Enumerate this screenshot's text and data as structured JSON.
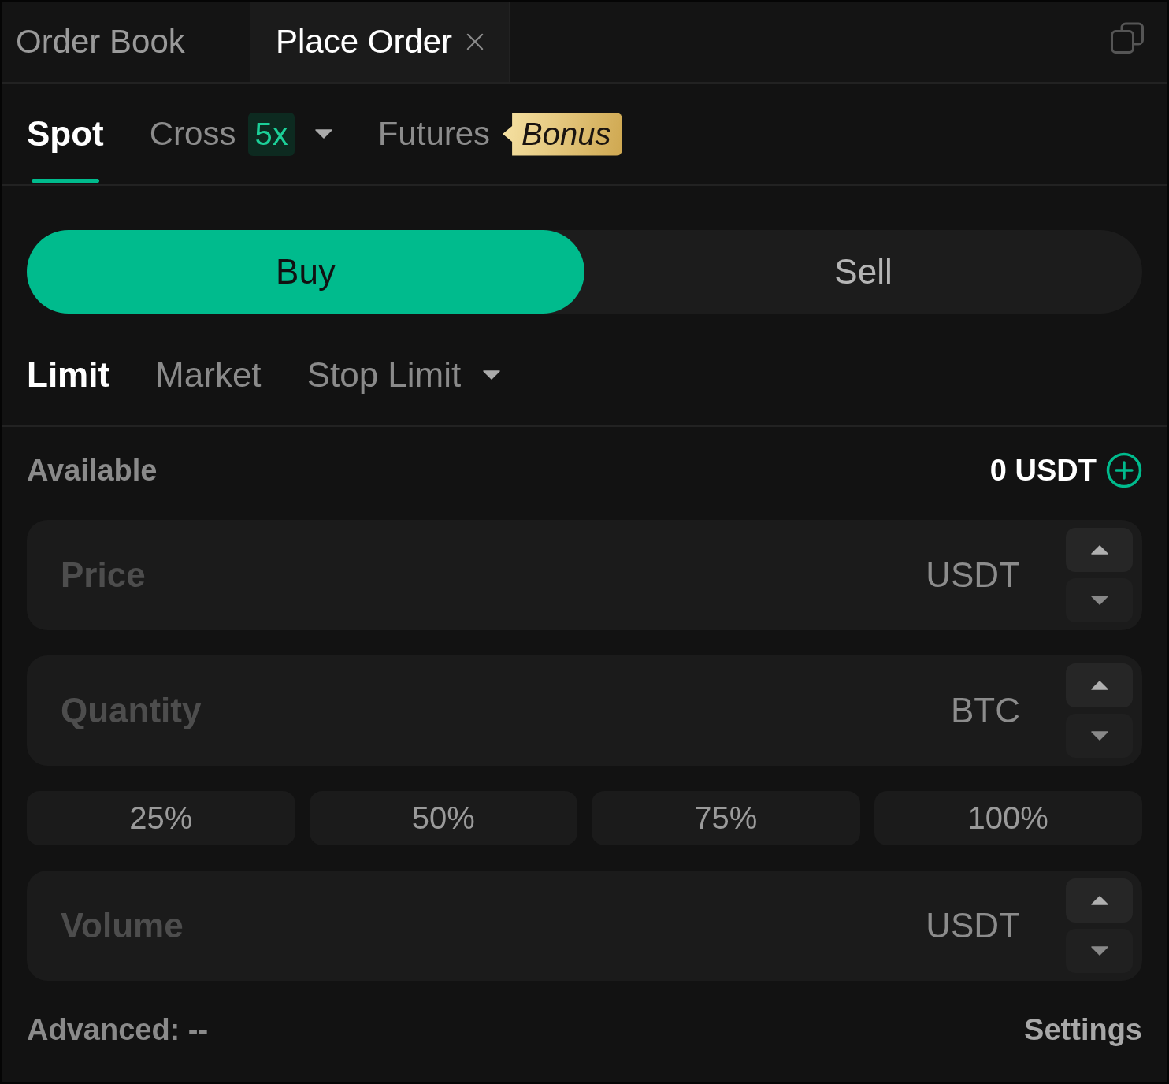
{
  "panel_tabs": [
    {
      "label": "Order Book",
      "selected": false,
      "closable": false
    },
    {
      "label": "Place Order",
      "selected": true,
      "closable": true
    }
  ],
  "market_tabs": [
    {
      "label": "Spot",
      "selected": true,
      "dropdown": false
    },
    {
      "label": "Cross",
      "selected": false,
      "dropdown": true,
      "badge": {
        "kind": "leverage",
        "text": "5x"
      }
    },
    {
      "label": "Futures",
      "selected": false,
      "dropdown": false,
      "badge": {
        "kind": "promo",
        "text": "Bonus"
      }
    }
  ],
  "side_toggle": [
    {
      "label": "Buy",
      "selected": true
    },
    {
      "label": "Sell",
      "selected": false
    }
  ],
  "order_types": [
    {
      "label": "Limit",
      "selected": true,
      "dropdown": false
    },
    {
      "label": "Market",
      "selected": false,
      "dropdown": false
    },
    {
      "label": "Stop Limit",
      "selected": false,
      "dropdown": true
    }
  ],
  "available": {
    "label": "Available",
    "value": "0 USDT"
  },
  "fields": [
    {
      "kind": "input",
      "placeholder": "Price",
      "unit": "USDT"
    },
    {
      "kind": "input",
      "placeholder": "Quantity",
      "unit": "BTC"
    },
    {
      "kind": "percent",
      "options": [
        "25%",
        "50%",
        "75%",
        "100%"
      ]
    },
    {
      "kind": "input",
      "placeholder": "Volume",
      "unit": "USDT"
    }
  ],
  "footer": {
    "advanced": "Advanced: --",
    "settings": "Settings"
  }
}
